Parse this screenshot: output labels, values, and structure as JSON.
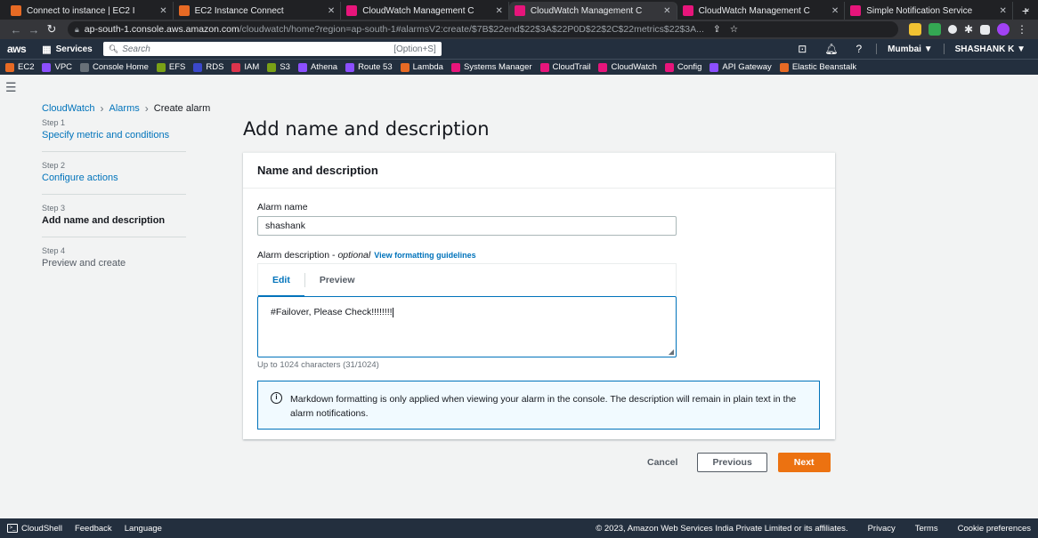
{
  "browser": {
    "tabs": [
      {
        "label": "Connect to instance | EC2 I",
        "favicon": "aws-ec2-icon",
        "color": "#e76a24",
        "active": false
      },
      {
        "label": "EC2 Instance Connect",
        "favicon": "aws-ec2-icon",
        "color": "#e76a24",
        "active": false
      },
      {
        "label": "CloudWatch Management C",
        "favicon": "cloudwatch-icon",
        "color": "#e7157b",
        "active": false
      },
      {
        "label": "CloudWatch Management C",
        "favicon": "cloudwatch-icon",
        "color": "#e7157b",
        "active": true
      },
      {
        "label": "CloudWatch Management C",
        "favicon": "cloudwatch-icon",
        "color": "#e7157b",
        "active": false
      },
      {
        "label": "Simple Notification Service",
        "favicon": "sns-icon",
        "color": "#e7157b",
        "active": false
      }
    ],
    "new_tab": "+",
    "url_host": "ap-south-1.console.aws.amazon.com",
    "url_path": "/cloudwatch/home?region=ap-south-1#alarmsV2:create/$7B$22end$22$3A$22P0D$22$2C$22metrics$22$3A..."
  },
  "aws_nav": {
    "logo": "aws",
    "services": "Services",
    "search_placeholder": "Search",
    "search_shortcut": "[Option+S]",
    "region": "Mumbai ▼",
    "user": "SHASHANK K ▼"
  },
  "favorites": [
    {
      "label": "EC2",
      "color": "#e76a24"
    },
    {
      "label": "VPC",
      "color": "#8c4fff"
    },
    {
      "label": "Console Home",
      "color": "#687078"
    },
    {
      "label": "EFS",
      "color": "#7aa116"
    },
    {
      "label": "RDS",
      "color": "#3b48cc"
    },
    {
      "label": "IAM",
      "color": "#dd344c"
    },
    {
      "label": "S3",
      "color": "#7aa116"
    },
    {
      "label": "Athena",
      "color": "#8c4fff"
    },
    {
      "label": "Route 53",
      "color": "#8c4fff"
    },
    {
      "label": "Lambda",
      "color": "#e76a24"
    },
    {
      "label": "Systems Manager",
      "color": "#e7157b"
    },
    {
      "label": "CloudTrail",
      "color": "#e7157b"
    },
    {
      "label": "CloudWatch",
      "color": "#e7157b"
    },
    {
      "label": "Config",
      "color": "#e7157b"
    },
    {
      "label": "API Gateway",
      "color": "#8c4fff"
    },
    {
      "label": "Elastic Beanstalk",
      "color": "#e76a24"
    }
  ],
  "breadcrumb": {
    "item1": "CloudWatch",
    "item2": "Alarms",
    "current": "Create alarm"
  },
  "steps": [
    {
      "num": "Step 1",
      "label": "Specify metric and conditions",
      "state": "link"
    },
    {
      "num": "Step 2",
      "label": "Configure actions",
      "state": "link"
    },
    {
      "num": "Step 3",
      "label": "Add name and description",
      "state": "current"
    },
    {
      "num": "Step 4",
      "label": "Preview and create",
      "state": "future"
    }
  ],
  "page": {
    "title": "Add name and description"
  },
  "form": {
    "panel_title": "Name and description",
    "alarm_name_label": "Alarm name",
    "alarm_name_value": "shashank",
    "description_label": "Alarm description - ",
    "description_optional": "optional",
    "formatting_link": "View formatting guidelines",
    "tab_edit": "Edit",
    "tab_preview": "Preview",
    "description_value": "#Failover, Please Check!!!!!!!!",
    "char_hint": "Up to 1024 characters (31/1024)",
    "info_text": "Markdown formatting is only applied when viewing your alarm in the console. The description will remain in plain text in the alarm notifications."
  },
  "actions": {
    "cancel": "Cancel",
    "previous": "Previous",
    "next": "Next"
  },
  "footer": {
    "cloudshell": "CloudShell",
    "feedback": "Feedback",
    "language": "Language",
    "copyright": "© 2023, Amazon Web Services India Private Limited or its affiliates.",
    "privacy": "Privacy",
    "terms": "Terms",
    "cookies": "Cookie preferences"
  },
  "colors": {
    "aws_nav": "#232f3e",
    "link": "#0073bb",
    "primary_button": "#ec7211"
  }
}
